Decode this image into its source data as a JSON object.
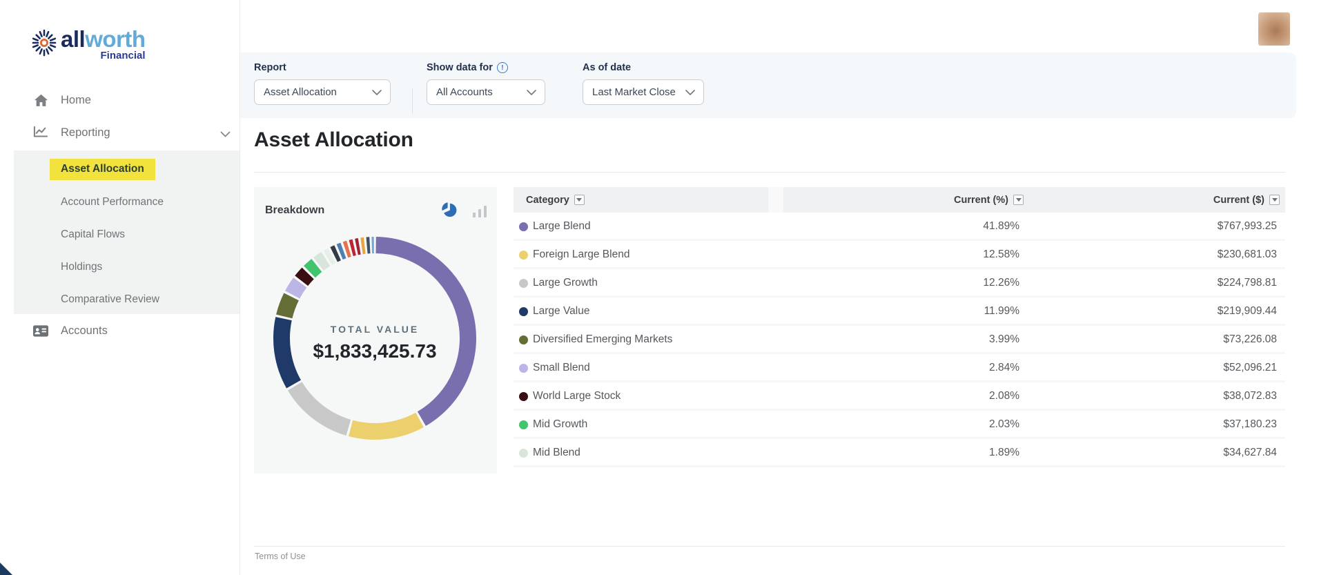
{
  "brand": {
    "name_primary": "all",
    "name_secondary": "worth",
    "name_sub": "Financial"
  },
  "sidebar": {
    "items": [
      {
        "label": "Home"
      },
      {
        "label": "Reporting"
      }
    ],
    "submenu": [
      {
        "label": "Asset Allocation",
        "active": true
      },
      {
        "label": "Account Performance"
      },
      {
        "label": "Capital Flows"
      },
      {
        "label": "Holdings"
      },
      {
        "label": "Comparative Review"
      }
    ],
    "accounts_label": "Accounts",
    "active_highlight_color": "#f2e23e"
  },
  "filters": {
    "report": {
      "label": "Report",
      "value": "Asset Allocation"
    },
    "show_data_for": {
      "label": "Show data for",
      "value": "All Accounts"
    },
    "as_of_date": {
      "label": "As of date",
      "value": "Last Market Close"
    }
  },
  "page": {
    "title": "Asset Allocation"
  },
  "breakdown": {
    "title": "Breakdown"
  },
  "chart_data": {
    "type": "donut",
    "title": "Breakdown",
    "center_label": "TOTAL VALUE",
    "center_value": "$1,833,425.73",
    "legend_position": "table-right",
    "segments": [
      {
        "label": "Large Blend",
        "pct": 41.89,
        "color": "#7a6fae"
      },
      {
        "label": "Foreign Large Blend",
        "pct": 12.58,
        "color": "#ecd06e"
      },
      {
        "label": "Large Growth",
        "pct": 12.26,
        "color": "#c8c8c8"
      },
      {
        "label": "Large Value",
        "pct": 11.99,
        "color": "#1f3a68"
      },
      {
        "label": "Diversified Emerging Markets",
        "pct": 3.99,
        "color": "#646d36"
      },
      {
        "label": "Small Blend",
        "pct": 2.84,
        "color": "#bcb6e6"
      },
      {
        "label": "World Large Stock",
        "pct": 2.08,
        "color": "#3a0f12"
      },
      {
        "label": "Mid Growth",
        "pct": 2.03,
        "color": "#41c46c"
      },
      {
        "label": "Mid Blend",
        "pct": 1.89,
        "color": "#d8e5db"
      },
      {
        "label": "",
        "pct": 1.2,
        "color": "#e7efe9"
      },
      {
        "label": "",
        "pct": 1.1,
        "color": "#313c47"
      },
      {
        "label": "",
        "pct": 1.05,
        "color": "#4e7fb1"
      },
      {
        "label": "",
        "pct": 1.0,
        "color": "#e5724d"
      },
      {
        "label": "",
        "pct": 0.95,
        "color": "#bf2433"
      },
      {
        "label": "",
        "pct": 0.9,
        "color": "#a02433"
      },
      {
        "label": "",
        "pct": 0.9,
        "color": "#eaa440"
      },
      {
        "label": "",
        "pct": 0.9,
        "color": "#3e5066"
      },
      {
        "label": "",
        "pct": 0.65,
        "color": "#72a7db"
      }
    ]
  },
  "table": {
    "columns": [
      "Category",
      "Current (%)",
      "Current ($)"
    ],
    "rows": [
      {
        "color": "#7a6fae",
        "category": "Large Blend",
        "current_pct": "41.89%",
        "current_usd": "$767,993.25"
      },
      {
        "color": "#ecd06e",
        "category": "Foreign Large Blend",
        "current_pct": "12.58%",
        "current_usd": "$230,681.03"
      },
      {
        "color": "#c8c8c8",
        "category": "Large Growth",
        "current_pct": "12.26%",
        "current_usd": "$224,798.81"
      },
      {
        "color": "#1f3a68",
        "category": "Large Value",
        "current_pct": "11.99%",
        "current_usd": "$219,909.44"
      },
      {
        "color": "#646d36",
        "category": "Diversified Emerging Markets",
        "current_pct": "3.99%",
        "current_usd": "$73,226.08"
      },
      {
        "color": "#bcb6e6",
        "category": "Small Blend",
        "current_pct": "2.84%",
        "current_usd": "$52,096.21"
      },
      {
        "color": "#3a0f12",
        "category": "World Large Stock",
        "current_pct": "2.08%",
        "current_usd": "$38,072.83"
      },
      {
        "color": "#41c46c",
        "category": "Mid Growth",
        "current_pct": "2.03%",
        "current_usd": "$37,180.23"
      },
      {
        "color": "#d8e5db",
        "category": "Mid Blend",
        "current_pct": "1.89%",
        "current_usd": "$34,627.84"
      }
    ]
  },
  "footer": {
    "terms": "Terms of Use"
  }
}
